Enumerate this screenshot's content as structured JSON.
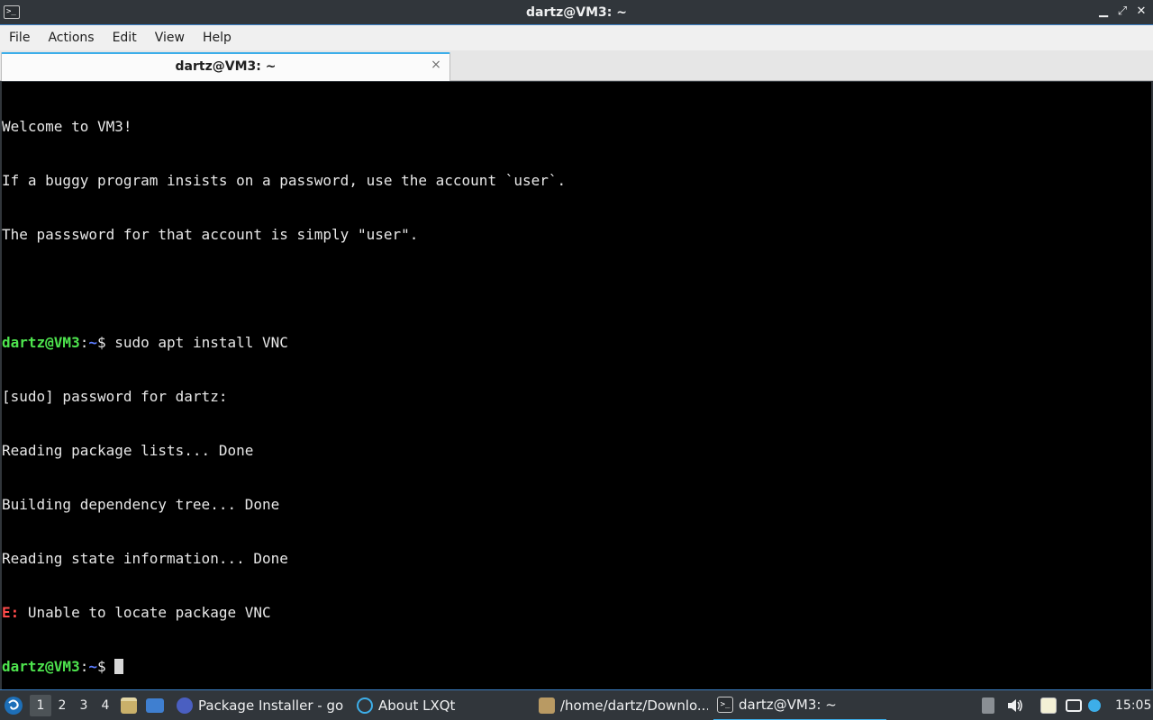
{
  "window": {
    "title": "dartz@VM3: ~",
    "minimize_glyph": "▁",
    "restore_glyph": "⤢",
    "close_glyph": "✕"
  },
  "menu": {
    "file": "File",
    "actions": "Actions",
    "edit": "Edit",
    "view": "View",
    "help": "Help"
  },
  "tab": {
    "label": "dartz@VM3: ~",
    "close_glyph": "×"
  },
  "terminal": {
    "lines": [
      "Welcome to VM3!",
      "If a buggy program insists on a password, use the account `user`.",
      "The passsword for that account is simply \"user\".",
      ""
    ],
    "prompt_user": "dartz@VM3",
    "prompt_sep": ":",
    "prompt_path": "~",
    "prompt_end": "$ ",
    "command": "sudo apt install VNC",
    "output": [
      "[sudo] password for dartz:",
      "Reading package lists... Done",
      "Building dependency tree... Done",
      "Reading state information... Done"
    ],
    "error_tag": "E:",
    "error_msg": " Unable to locate package VNC"
  },
  "taskbar": {
    "desktops": [
      "1",
      "2",
      "3",
      "4"
    ],
    "tasks": [
      {
        "label": "Package Installer - go...",
        "icon": "package-installer-icon"
      },
      {
        "label": "About LXQt",
        "icon": "lxqt-icon"
      },
      {
        "label": "/home/dartz/Downlo...",
        "icon": "file-manager-icon"
      },
      {
        "label": "dartz@VM3: ~",
        "icon": "terminal-icon"
      }
    ],
    "clock": "15:05"
  },
  "colors": {
    "accent": "#3daee9",
    "prompt_green": "#4ee44e",
    "prompt_blue": "#5c7cff",
    "error_red": "#ff4b4b"
  }
}
